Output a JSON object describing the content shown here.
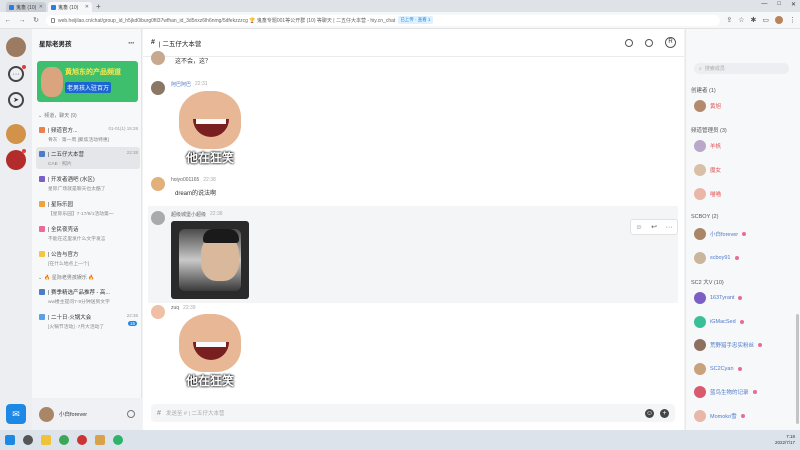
{
  "browser": {
    "tabs": [
      {
        "label": "鬼畜 (10)"
      },
      {
        "label": "鬼畜 (10)"
      }
    ],
    "new_tab": "+",
    "window_controls": [
      "—",
      "□",
      "✕"
    ],
    "url": "web.heijilao.cn/chat/group_id_h5jkd0iburg0ftl37wfhan_id_3d5nxz6lh6nmg/5dfekzzzcg 🏆 鬼畜专题001等公开群 (10) 等聊天 | 二五仔大本营 - hiy.cn_chat",
    "extension_badge": "已上传 · 查看 1"
  },
  "rail": {
    "bottom_icon_label": "rHnp"
  },
  "channels": {
    "server_name": "星际老男孩",
    "more_icon": "···",
    "banner": {
      "headline": "黄旭东的产品频道",
      "subline": "老男孩入驻百万"
    },
    "section1": "频道，聊天 (9)",
    "items": [
      {
        "title": "| 频道官方...",
        "time": "01-01(1) 15:28",
        "sub": "骨灰 · 第一周 [聚焦活动特惠]",
        "active": false,
        "color": "#e8814c"
      },
      {
        "title": "| 二五仔大本营",
        "time": "22:38",
        "sub": "CAE · 照片",
        "active": true,
        "color": "#4f7ac9"
      },
      {
        "title": "| 开发者酒吧 (水区)",
        "time": "",
        "sub": "星际广场就是聊天也太酷了",
        "active": false,
        "color": "#7b5fc4"
      },
      {
        "title": "| 星际乐园",
        "time": "",
        "sub": "【星际乐园】7·17/8/1活动第一",
        "active": false,
        "color": "#f0a13a"
      },
      {
        "title": "| 全民夜壳话",
        "time": "",
        "sub": "不能在这里发什么文字发言",
        "active": false,
        "color": "#e96b9c"
      },
      {
        "title": "| 公告与官方",
        "time": "",
        "sub": "[在什么地点上一个]",
        "active": false,
        "color": "#f5c542"
      }
    ],
    "section2": "🔥 星际老男孩娱乐 🔥",
    "items2": [
      {
        "title": "| 赛季精选产品推荐 - 高...",
        "time": "",
        "sub": "ww楼主提问7·9分钟送到文字",
        "color": "#4f7ac9",
        "badge": ""
      },
      {
        "title": "| 二十日·火锅大会",
        "time": "22:36",
        "sub": "[火锅节活动] ·7月大活动了",
        "color": "#5aa0e6",
        "badge": "15"
      }
    ],
    "user_name": "小白forever"
  },
  "main": {
    "channel_title": "| 二五仔大本营",
    "hash": "#",
    "messages": [
      {
        "name": "",
        "time": "",
        "text": "这不会，这？",
        "type": "text",
        "avatar": "#c7a890",
        "name_color_dark": false
      },
      {
        "name": "阿巴阿巴",
        "time": "22:31",
        "text": "",
        "type": "meme1",
        "caption": "他在狂笑",
        "avatar": "#8a7766",
        "name_color_dark": false
      },
      {
        "name": "hoiyo001165",
        "time": "22:38",
        "text": "dream的说法啊",
        "type": "text",
        "avatar": "#e2b07a",
        "name_color_dark": true
      },
      {
        "name": "超级城堡小超级",
        "time": "22:38",
        "text": "",
        "type": "meme2",
        "caption": "",
        "avatar": "#aaaaaa",
        "name_color_dark": true
      },
      {
        "name": "zuq",
        "time": "22:39",
        "text": "",
        "type": "meme1",
        "caption": "他在狂笑",
        "avatar": "#f0c0a6",
        "name_color_dark": true
      }
    ],
    "composer_placeholder": "发送至 # | 二五仔大本营"
  },
  "members": {
    "search_placeholder": "搜索成员",
    "groups": [
      {
        "label": "创建者 (1)",
        "members": [
          {
            "name": "黄旭",
            "color": "#e05454",
            "avatar": "#b38a6e"
          }
        ]
      },
      {
        "label": "频道管理员 (3)",
        "members": [
          {
            "name": "羊帆",
            "color": "#e05454",
            "avatar": "#b9a8c9"
          },
          {
            "name": "魔女",
            "color": "#e05454",
            "avatar": "#d8c0a8"
          },
          {
            "name": "喵喵",
            "color": "#e05454",
            "avatar": "#e8b7a8"
          }
        ]
      },
      {
        "label": "SCBOY (2)",
        "members": [
          {
            "name": "小白forever",
            "color": "#4f7ac9",
            "avatar": "#a98667"
          },
          {
            "name": "scboy91",
            "color": "#4f7ac9",
            "avatar": "#c9b69b"
          }
        ]
      },
      {
        "label": "SC2 大V (10)",
        "members": [
          {
            "name": "163Tyrant",
            "color": "#4f7ac9",
            "avatar": "#7c5fc4"
          },
          {
            "name": "iGMacSed",
            "color": "#4f7ac9",
            "avatar": "#3bbf98"
          },
          {
            "name": "荒野猎手忠实粉丝",
            "color": "#4f7ac9",
            "avatar": "#8e7060"
          },
          {
            "name": "SC2Cyan",
            "color": "#4f7ac9",
            "avatar": "#c9a27c"
          },
          {
            "name": "蓝鸟生物的记录",
            "color": "#4f7ac9",
            "avatar": "#d85a6d"
          },
          {
            "name": "Momoko雪",
            "color": "#4f7ac9",
            "avatar": "#e8b7a8"
          }
        ]
      }
    ]
  },
  "taskbar": {
    "time": "7:18",
    "date": "2022/7/17"
  }
}
